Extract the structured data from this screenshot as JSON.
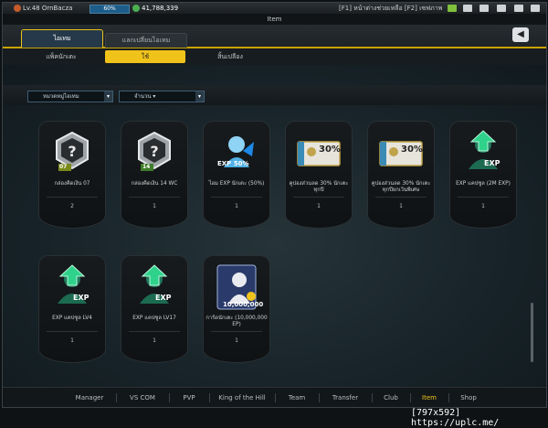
{
  "topbar": {
    "level": "Lv.48 OrnBacza",
    "exp_percent": "60%",
    "money": "41,788,339",
    "hint": "[F1] หน้าต่างช่วยเหลือ [F2] เซฟภาพ"
  },
  "header": {
    "title": "Item"
  },
  "tabs": [
    {
      "label": "ไอเทม"
    },
    {
      "label": "แลกเปลี่ยนไอเทม"
    }
  ],
  "subtabs": [
    {
      "label": "แพ็คนักเตะ"
    },
    {
      "label": "ใช้"
    },
    {
      "label": "สิ้นเปลือง"
    }
  ],
  "filters": {
    "category": "หมวดหมู่ไอเทม",
    "sort": "จำนวน ▾"
  },
  "items": [
    {
      "name": "กล่องคิดเงิน 07",
      "qty": "2",
      "art": "silver-pack",
      "badge": "07"
    },
    {
      "name": "กล่องคิดเงิน 14 WC",
      "qty": "1",
      "art": "silver-pack",
      "badge": "14"
    },
    {
      "name": "ไอม EXP นักเตะ (50%)",
      "qty": "1",
      "art": "exp-50",
      "badge": "EXP 50%"
    },
    {
      "name": "คูปองส่วนลด 30% นักเตะทุกปี",
      "qty": "1",
      "art": "coupon-special",
      "badge": "30%"
    },
    {
      "name": "คูปองส่วนลด 30% นักเตะทุกปียกเว้นพิเศษ",
      "qty": "1",
      "art": "coupon",
      "badge": "30%"
    },
    {
      "name": "EXP แคปซูล (2M EXP)",
      "qty": "1",
      "art": "exp-capsule",
      "badge": "EXP"
    },
    {
      "name": "EXP แคปซูล LV4",
      "qty": "1",
      "art": "exp-capsule",
      "badge": "EXP"
    },
    {
      "name": "EXP แคปซูล LV17",
      "qty": "1",
      "art": "exp-capsule",
      "badge": "EXP"
    },
    {
      "name": "การ์ดนักเตะ (10,000,000 EP)",
      "qty": "1",
      "art": "player-card",
      "badge": "10,000,000"
    }
  ],
  "nav": [
    {
      "label": "Manager"
    },
    {
      "label": "VS COM"
    },
    {
      "label": "PVP"
    },
    {
      "label": "King of the Hill"
    },
    {
      "label": "Team"
    },
    {
      "label": "Transfer"
    },
    {
      "label": "Club"
    },
    {
      "label": "Item"
    },
    {
      "label": "Shop"
    }
  ],
  "watermark": "[797x592] https://uplc.me/",
  "colors": {
    "accent": "#f0c31a",
    "exp_green": "#2fd28a",
    "bg": "#181e22"
  }
}
